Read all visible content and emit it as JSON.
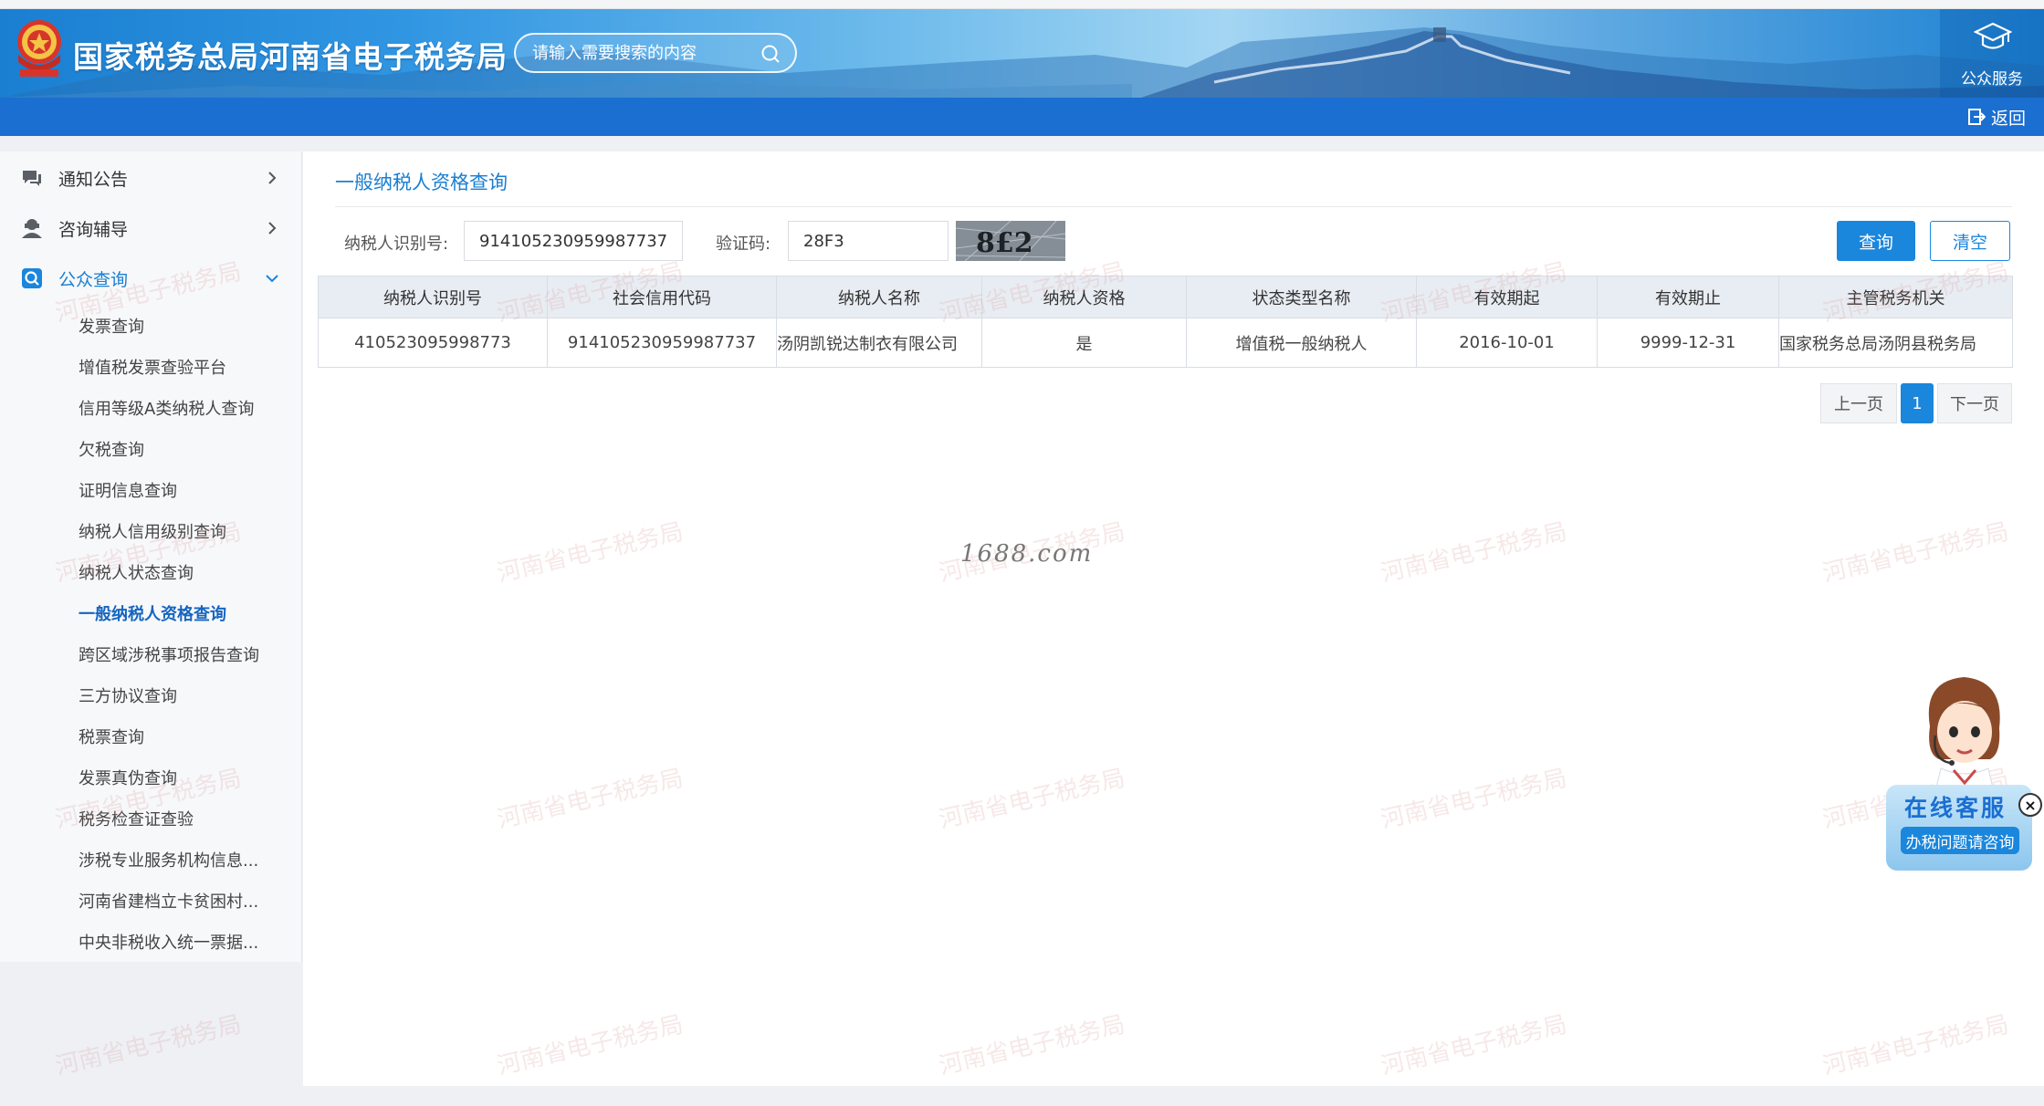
{
  "header": {
    "site_title": "国家税务总局河南省电子税务局",
    "search_placeholder": "请输入需要搜索的内容",
    "public_service_label": "公众服务",
    "back_label": "返回"
  },
  "sidebar": {
    "menus": [
      {
        "label": "通知公告",
        "icon": "chat-bubble-icon",
        "expanded": false
      },
      {
        "label": "咨询辅导",
        "icon": "person-support-icon",
        "expanded": false
      },
      {
        "label": "公众查询",
        "icon": "search-icon",
        "expanded": true
      }
    ],
    "sub_items": [
      {
        "label": "发票查询"
      },
      {
        "label": "增值税发票查验平台"
      },
      {
        "label": "信用等级A类纳税人查询"
      },
      {
        "label": "欠税查询"
      },
      {
        "label": "证明信息查询"
      },
      {
        "label": "纳税人信用级别查询"
      },
      {
        "label": "纳税人状态查询"
      },
      {
        "label": "一般纳税人资格查询",
        "active": true
      },
      {
        "label": "跨区域涉税事项报告查询"
      },
      {
        "label": "三方协议查询"
      },
      {
        "label": "税票查询"
      },
      {
        "label": "发票真伪查询"
      },
      {
        "label": "税务检查证查验"
      },
      {
        "label": "涉税专业服务机构信息..."
      },
      {
        "label": "河南省建档立卡贫困村..."
      },
      {
        "label": "中央非税收入统一票据..."
      }
    ]
  },
  "main": {
    "page_title": "一般纳税人资格查询",
    "form": {
      "taxpayer_id_label": "纳税人识别号:",
      "taxpayer_id_value": "914105230959987737",
      "captcha_label": "验证码:",
      "captcha_value": "28F3",
      "captcha_image_text": "8£2",
      "query_label": "查询",
      "clear_label": "清空"
    },
    "table": {
      "headers": [
        "纳税人识别号",
        "社会信用代码",
        "纳税人名称",
        "纳税人资格",
        "状态类型名称",
        "有效期起",
        "有效期止",
        "主管税务机关"
      ],
      "rows": [
        [
          "410523095998773",
          "914105230959987737",
          "汤阴凯锐达制衣有限公司",
          "是",
          "增值税一般纳税人",
          "2016-10-01",
          "9999-12-31",
          "国家税务总局汤阴县税务局"
        ]
      ]
    },
    "pagination": {
      "prev_label": "上一页",
      "current_page": "1",
      "next_label": "下一页"
    }
  },
  "watermark": {
    "text": "河南省电子税务局",
    "site_mark": "1688.com"
  },
  "chat_widget": {
    "title": "在线客服",
    "subtitle": "办税问题请咨询",
    "close_label": "×"
  },
  "colors": {
    "brand_blue": "#1a86dc",
    "nav_blue": "#1a6fd1",
    "active_link": "#1565c0"
  }
}
